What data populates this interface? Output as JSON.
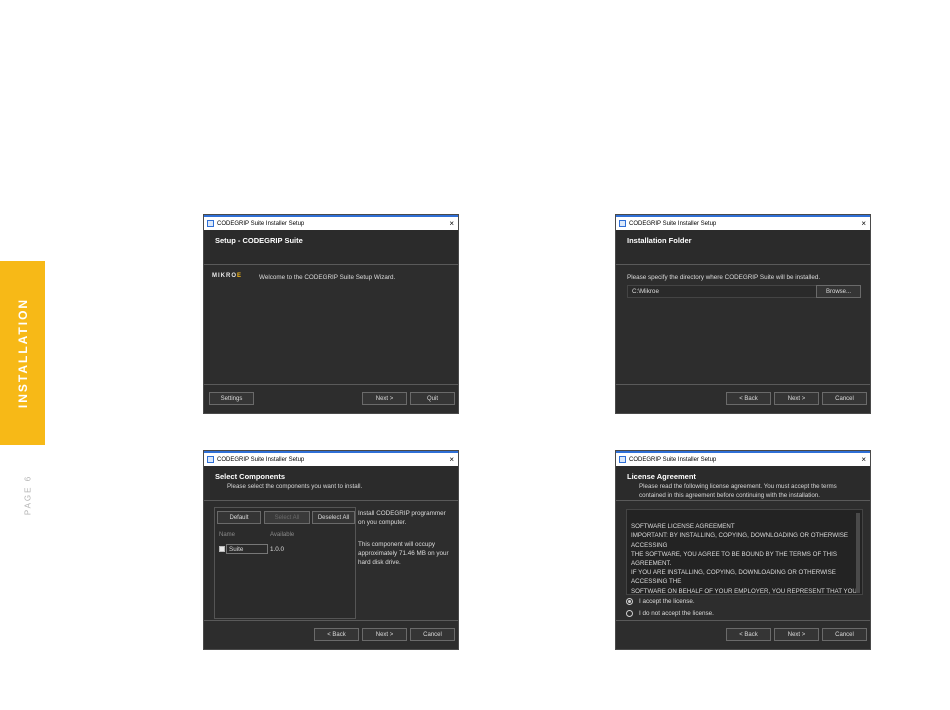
{
  "sidebar": {
    "section_label": "INSTALLATION",
    "page_label": "PAGE 6",
    "accent_color": "#f7b917"
  },
  "windows": {
    "welcome": {
      "title": "CODEGRIP Suite Installer Setup",
      "close": "×",
      "header_title": "Setup - CODEGRIP Suite",
      "logo": "MIKRO",
      "logo_accent": "E",
      "welcome_text": "Welcome to the CODEGRIP Suite Setup Wizard.",
      "buttons": {
        "settings": "Settings",
        "next": "Next >",
        "quit": "Quit"
      }
    },
    "folder": {
      "title": "CODEGRIP Suite Installer Setup",
      "close": "×",
      "header_title": "Installation Folder",
      "instruction": "Please specify the directory where CODEGRIP Suite will be installed.",
      "path_value": "C:\\Mikroe",
      "buttons": {
        "browse": "Browse...",
        "back": "< Back",
        "next": "Next >",
        "cancel": "Cancel"
      }
    },
    "components": {
      "title": "CODEGRIP Suite Installer Setup",
      "close": "×",
      "header_title": "Select Components",
      "header_sub": "Please select the components you want to install.",
      "buttons": {
        "default": "Default",
        "select_all": "Select All",
        "deselect_all": "Deselect All",
        "back": "< Back",
        "next": "Next >",
        "cancel": "Cancel"
      },
      "columns": [
        "Name",
        "Available"
      ],
      "items": [
        {
          "name": "Suite",
          "version": "1.0.0",
          "checked": true
        }
      ],
      "description": "Install CODEGRIP programmer on you computer.",
      "size_note": "This component will occupy approximately 71.46 MB on your hard disk drive."
    },
    "license": {
      "title": "CODEGRIP Suite Installer Setup",
      "close": "×",
      "header_title": "License Agreement",
      "header_sub": "Please read the following license agreement. You must accept the terms contained in this agreement before continuing with the installation.",
      "license_text": "SOFTWARE LICENSE AGREEMENT\nIMPORTANT: BY INSTALLING, COPYING, DOWNLOADING OR OTHERWISE ACCESSING\nTHE SOFTWARE, YOU AGREE TO BE BOUND BY THE TERMS OF THIS AGREEMENT.\nIF YOU ARE INSTALLING, COPYING, DOWNLOADING OR OTHERWISE ACCESSING THE\nSOFTWARE ON BEHALF OF YOUR EMPLOYER, YOU REPRESENT THAT YOU ARE",
      "accept": "I accept the license.",
      "decline": "I do not accept the license.",
      "accepted": true,
      "buttons": {
        "back": "< Back",
        "next": "Next >",
        "cancel": "Cancel"
      }
    }
  }
}
